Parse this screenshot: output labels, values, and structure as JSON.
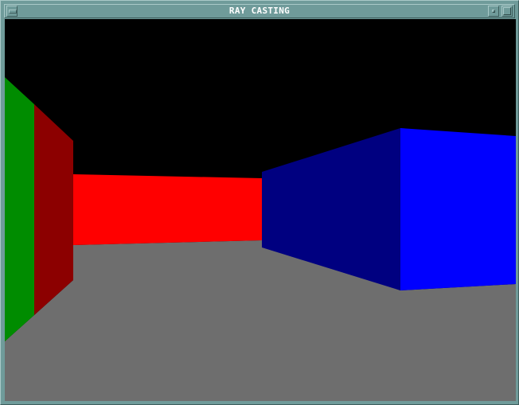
{
  "window": {
    "title": "RAY CASTING"
  },
  "titlebar_icons": {
    "menu": "window-menu-icon",
    "minimize": "minimize-icon",
    "maximize": "maximize-icon"
  },
  "scene": {
    "colors": {
      "ceiling": "#000000",
      "floor": "#6e6e6e",
      "green_wall": "#008c00",
      "dark_red_wall": "#8c0000",
      "red_wall": "#ff0000",
      "dark_blue_wall": "#000080",
      "blue_wall": "#0000ff",
      "frame": "#6f9b9a"
    }
  }
}
